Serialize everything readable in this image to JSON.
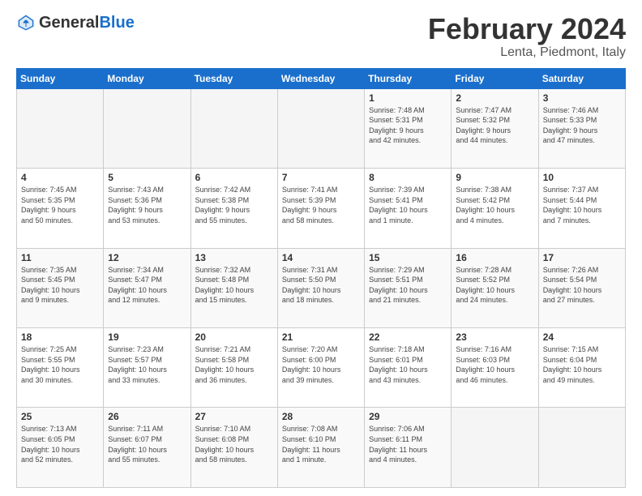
{
  "logo": {
    "general": "General",
    "blue": "Blue"
  },
  "header": {
    "title": "February 2024",
    "subtitle": "Lenta, Piedmont, Italy"
  },
  "weekdays": [
    "Sunday",
    "Monday",
    "Tuesday",
    "Wednesday",
    "Thursday",
    "Friday",
    "Saturday"
  ],
  "weeks": [
    [
      {
        "day": "",
        "info": ""
      },
      {
        "day": "",
        "info": ""
      },
      {
        "day": "",
        "info": ""
      },
      {
        "day": "",
        "info": ""
      },
      {
        "day": "1",
        "info": "Sunrise: 7:48 AM\nSunset: 5:31 PM\nDaylight: 9 hours\nand 42 minutes."
      },
      {
        "day": "2",
        "info": "Sunrise: 7:47 AM\nSunset: 5:32 PM\nDaylight: 9 hours\nand 44 minutes."
      },
      {
        "day": "3",
        "info": "Sunrise: 7:46 AM\nSunset: 5:33 PM\nDaylight: 9 hours\nand 47 minutes."
      }
    ],
    [
      {
        "day": "4",
        "info": "Sunrise: 7:45 AM\nSunset: 5:35 PM\nDaylight: 9 hours\nand 50 minutes."
      },
      {
        "day": "5",
        "info": "Sunrise: 7:43 AM\nSunset: 5:36 PM\nDaylight: 9 hours\nand 53 minutes."
      },
      {
        "day": "6",
        "info": "Sunrise: 7:42 AM\nSunset: 5:38 PM\nDaylight: 9 hours\nand 55 minutes."
      },
      {
        "day": "7",
        "info": "Sunrise: 7:41 AM\nSunset: 5:39 PM\nDaylight: 9 hours\nand 58 minutes."
      },
      {
        "day": "8",
        "info": "Sunrise: 7:39 AM\nSunset: 5:41 PM\nDaylight: 10 hours\nand 1 minute."
      },
      {
        "day": "9",
        "info": "Sunrise: 7:38 AM\nSunset: 5:42 PM\nDaylight: 10 hours\nand 4 minutes."
      },
      {
        "day": "10",
        "info": "Sunrise: 7:37 AM\nSunset: 5:44 PM\nDaylight: 10 hours\nand 7 minutes."
      }
    ],
    [
      {
        "day": "11",
        "info": "Sunrise: 7:35 AM\nSunset: 5:45 PM\nDaylight: 10 hours\nand 9 minutes."
      },
      {
        "day": "12",
        "info": "Sunrise: 7:34 AM\nSunset: 5:47 PM\nDaylight: 10 hours\nand 12 minutes."
      },
      {
        "day": "13",
        "info": "Sunrise: 7:32 AM\nSunset: 5:48 PM\nDaylight: 10 hours\nand 15 minutes."
      },
      {
        "day": "14",
        "info": "Sunrise: 7:31 AM\nSunset: 5:50 PM\nDaylight: 10 hours\nand 18 minutes."
      },
      {
        "day": "15",
        "info": "Sunrise: 7:29 AM\nSunset: 5:51 PM\nDaylight: 10 hours\nand 21 minutes."
      },
      {
        "day": "16",
        "info": "Sunrise: 7:28 AM\nSunset: 5:52 PM\nDaylight: 10 hours\nand 24 minutes."
      },
      {
        "day": "17",
        "info": "Sunrise: 7:26 AM\nSunset: 5:54 PM\nDaylight: 10 hours\nand 27 minutes."
      }
    ],
    [
      {
        "day": "18",
        "info": "Sunrise: 7:25 AM\nSunset: 5:55 PM\nDaylight: 10 hours\nand 30 minutes."
      },
      {
        "day": "19",
        "info": "Sunrise: 7:23 AM\nSunset: 5:57 PM\nDaylight: 10 hours\nand 33 minutes."
      },
      {
        "day": "20",
        "info": "Sunrise: 7:21 AM\nSunset: 5:58 PM\nDaylight: 10 hours\nand 36 minutes."
      },
      {
        "day": "21",
        "info": "Sunrise: 7:20 AM\nSunset: 6:00 PM\nDaylight: 10 hours\nand 39 minutes."
      },
      {
        "day": "22",
        "info": "Sunrise: 7:18 AM\nSunset: 6:01 PM\nDaylight: 10 hours\nand 43 minutes."
      },
      {
        "day": "23",
        "info": "Sunrise: 7:16 AM\nSunset: 6:03 PM\nDaylight: 10 hours\nand 46 minutes."
      },
      {
        "day": "24",
        "info": "Sunrise: 7:15 AM\nSunset: 6:04 PM\nDaylight: 10 hours\nand 49 minutes."
      }
    ],
    [
      {
        "day": "25",
        "info": "Sunrise: 7:13 AM\nSunset: 6:05 PM\nDaylight: 10 hours\nand 52 minutes."
      },
      {
        "day": "26",
        "info": "Sunrise: 7:11 AM\nSunset: 6:07 PM\nDaylight: 10 hours\nand 55 minutes."
      },
      {
        "day": "27",
        "info": "Sunrise: 7:10 AM\nSunset: 6:08 PM\nDaylight: 10 hours\nand 58 minutes."
      },
      {
        "day": "28",
        "info": "Sunrise: 7:08 AM\nSunset: 6:10 PM\nDaylight: 11 hours\nand 1 minute."
      },
      {
        "day": "29",
        "info": "Sunrise: 7:06 AM\nSunset: 6:11 PM\nDaylight: 11 hours\nand 4 minutes."
      },
      {
        "day": "",
        "info": ""
      },
      {
        "day": "",
        "info": ""
      }
    ]
  ]
}
